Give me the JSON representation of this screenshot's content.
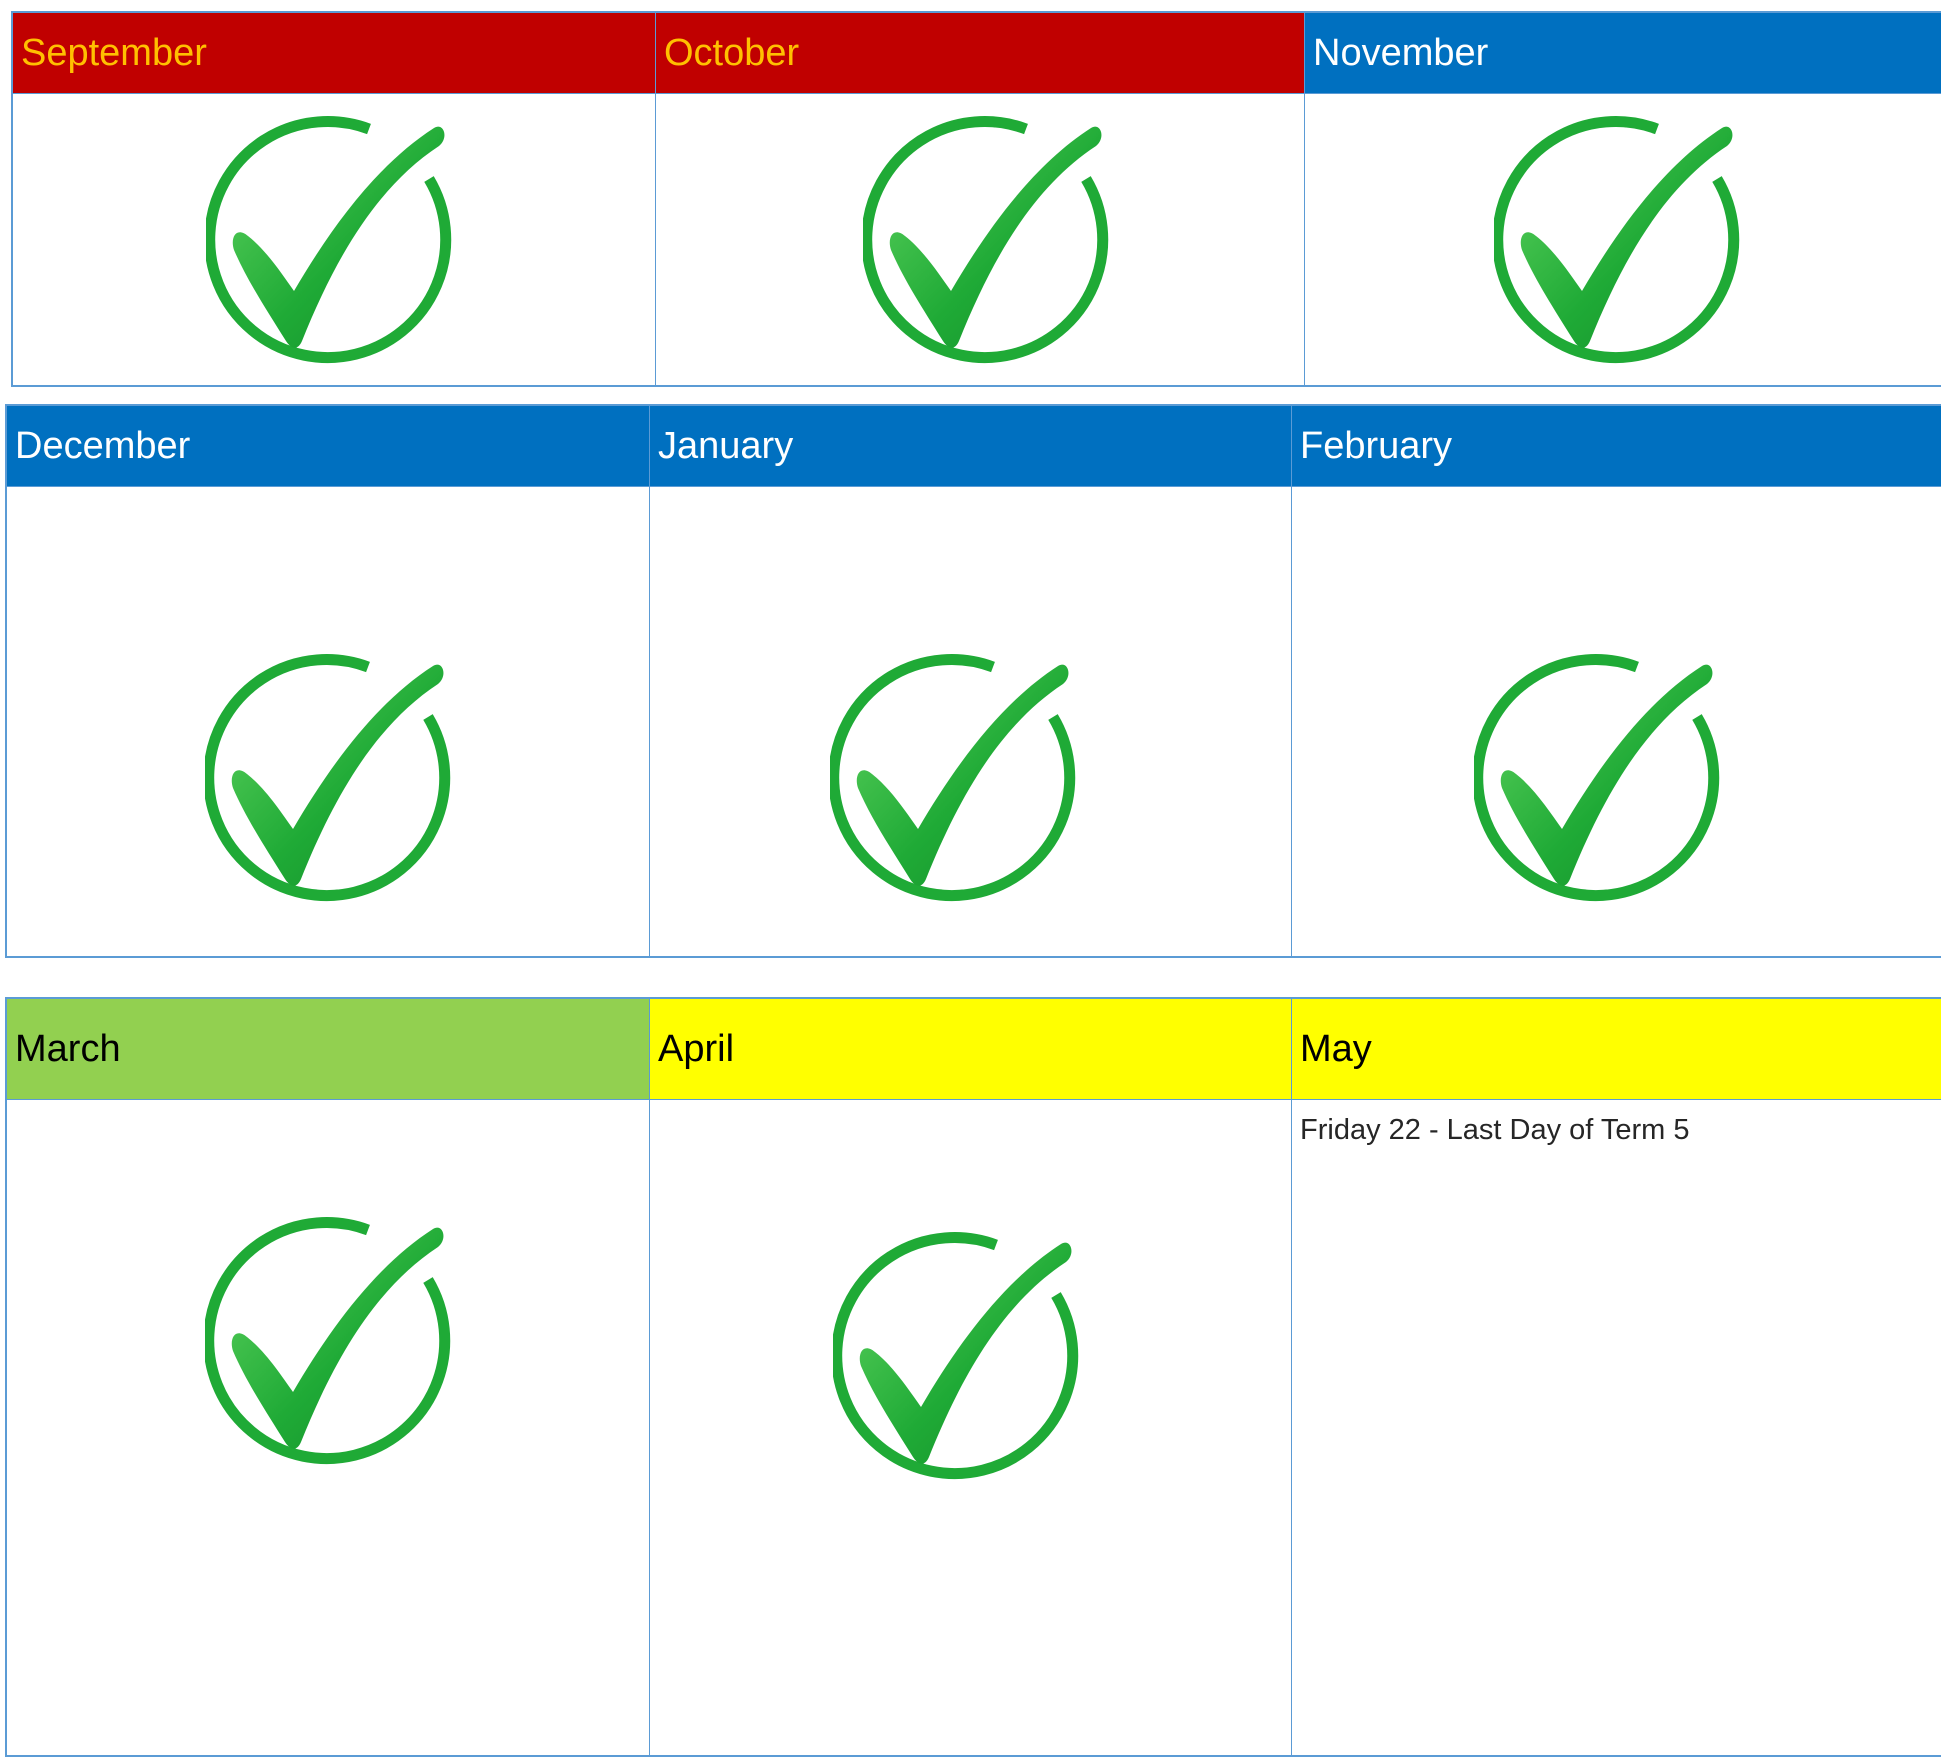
{
  "colors": {
    "header_red": "#c00000",
    "header_red_text": "#ffc000",
    "header_blue": "#0070c0",
    "header_green": "#92d050",
    "header_yellow": "#ffff00",
    "grid_border": "#5b9bd5",
    "check_green": "#1faa36"
  },
  "rows": [
    {
      "months": [
        {
          "name": "September",
          "status_icon": "check-circle-icon"
        },
        {
          "name": "October",
          "status_icon": "check-circle-icon"
        },
        {
          "name": "November",
          "status_icon": "check-circle-icon"
        }
      ]
    },
    {
      "months": [
        {
          "name": "December",
          "status_icon": "check-circle-icon"
        },
        {
          "name": "January",
          "status_icon": "check-circle-icon"
        },
        {
          "name": "February",
          "status_icon": "check-circle-icon"
        }
      ]
    },
    {
      "months": [
        {
          "name": "March",
          "status_icon": "check-circle-icon"
        },
        {
          "name": "April",
          "status_icon": "check-circle-icon"
        },
        {
          "name": "May",
          "note": "Friday 22 - Last Day of Term 5"
        }
      ]
    }
  ]
}
